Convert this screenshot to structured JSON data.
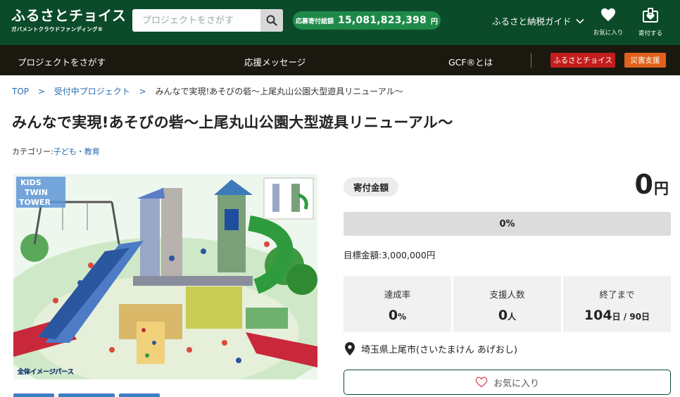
{
  "header": {
    "logo_main": "ふるさとチョイス",
    "logo_sub": "ガバメントクラウドファンディング®",
    "search_placeholder": "プロジェクトをさがす",
    "total_label": "応募寄付総額",
    "total_value": "15,081,823,398",
    "total_unit": "円",
    "guide": "ふるさと納税ガイド",
    "favorites": "お気に入り",
    "donate": "寄付する"
  },
  "nav": {
    "search": "プロジェクトをさがす",
    "messages": "応援メッセージ",
    "gcf": "GCF®とは",
    "badge_choice": "ふるさとチョイス",
    "badge_disaster": "災害支援"
  },
  "breadcrumb": {
    "top": "TOP",
    "accepting": "受付中プロジェクト",
    "current": "みんなで実現!あそびの砦〜上尾丸山公園大型遊具リニューアル〜"
  },
  "project": {
    "title": "みんなで実現!あそびの砦〜上尾丸山公園大型遊具リニューアル〜",
    "category_label": "カテゴリー:",
    "category": "子ども・教育"
  },
  "image": {
    "kids_line1": "KIDS",
    "kids_line2": "TWIN",
    "kids_line3": "TOWER",
    "caption": "全体イメージパース"
  },
  "funding": {
    "amount_label": "寄付金額",
    "amount": "0",
    "amount_unit": "円",
    "progress_percent": 0,
    "progress_text": "0%",
    "goal_text": "目標金額:3,000,000円",
    "rate_label": "達成率",
    "rate_value": "0",
    "rate_unit": "%",
    "supporters_label": "支援人数",
    "supporters_value": "0",
    "supporters_unit": "人",
    "remaining_label": "終了まで",
    "remaining_value": "104",
    "remaining_unit": "日",
    "remaining_total": " / 90日",
    "location": "埼玉県上尾市(さいたまけん あげおし)",
    "fav_button": "お気に入り"
  },
  "colors": {
    "header_bg": "#0b4b2a",
    "nav_bg": "#1b180f",
    "accent_green": "#1e8a4a",
    "badge_red": "#c41d1d",
    "badge_orange": "#e0621d",
    "link_blue": "#2a6db0"
  }
}
